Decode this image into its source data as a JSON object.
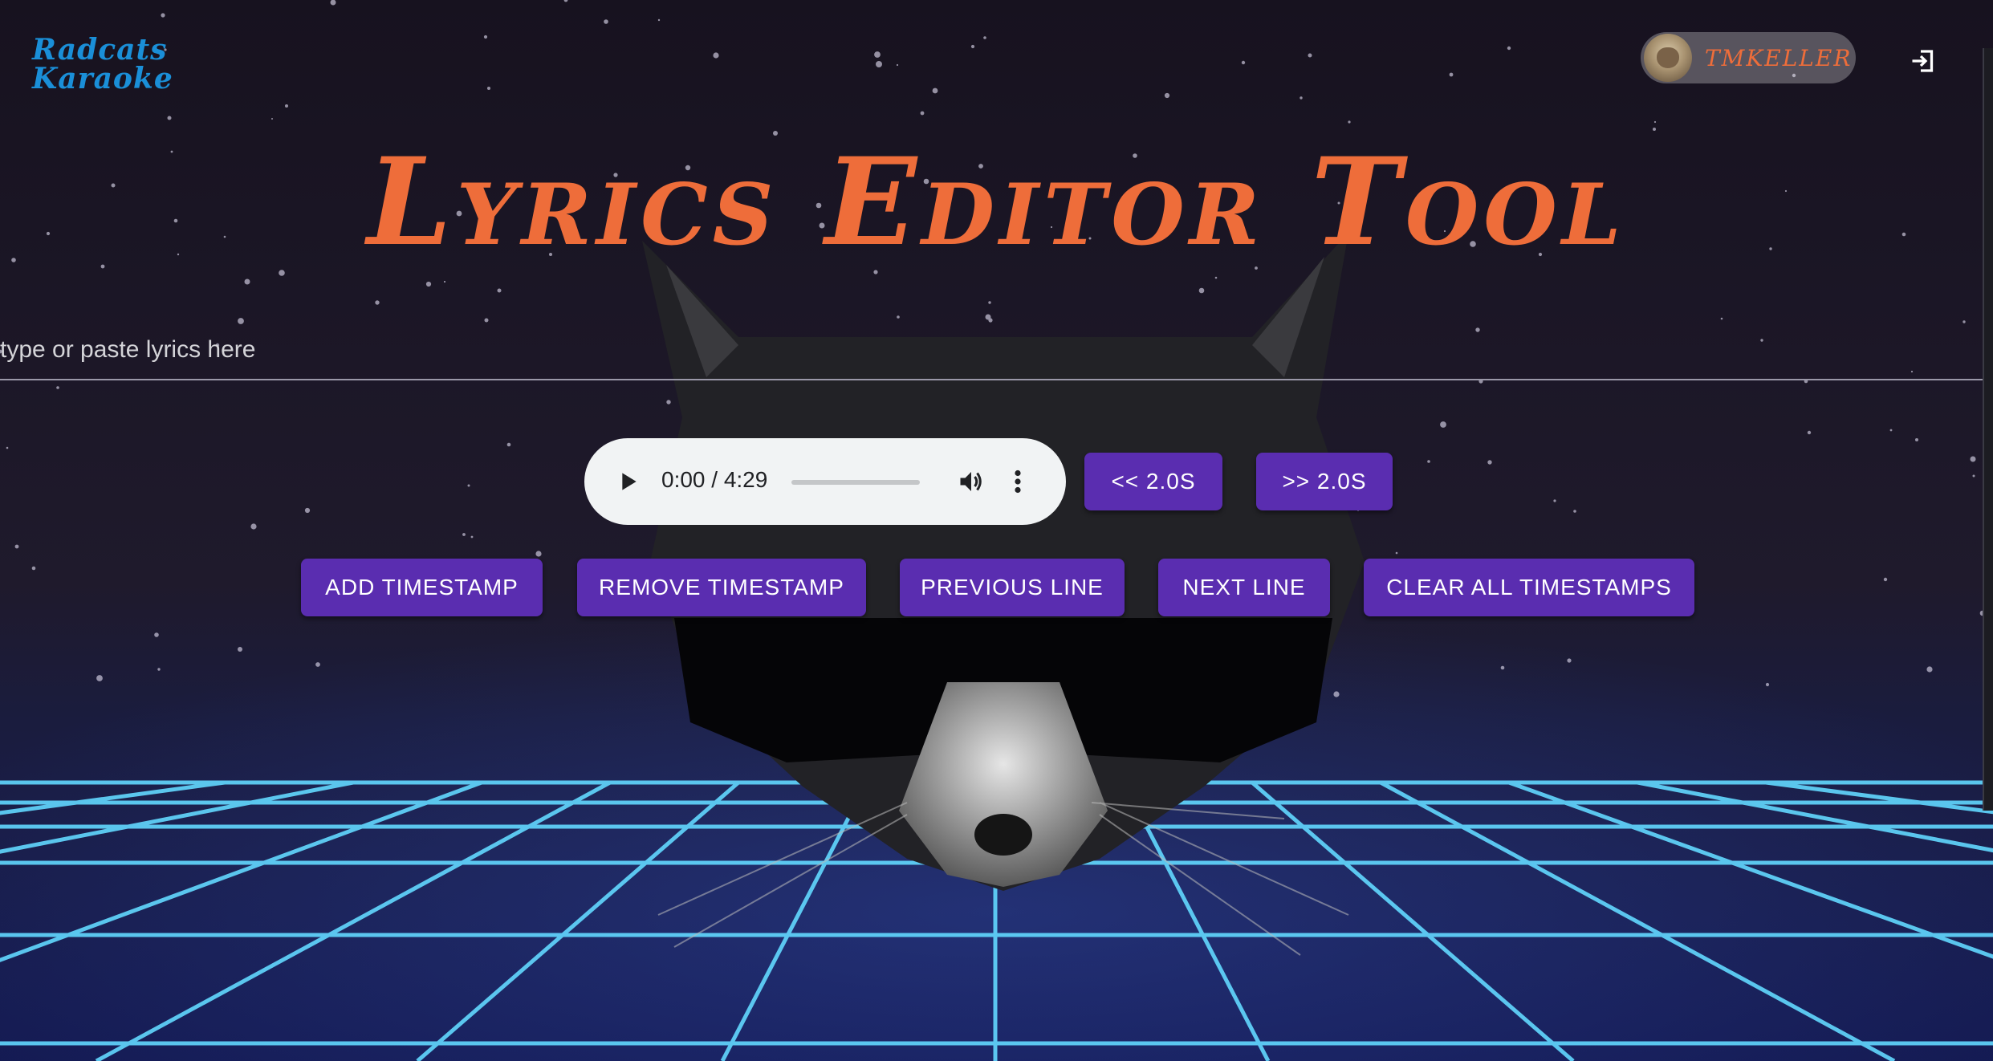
{
  "app": {
    "logo_line1": "Radcats",
    "logo_line2": "Karaoke"
  },
  "header": {
    "username": "TMKELLER",
    "avatar_icon": "cat-avatar-icon",
    "logout_icon": "logout-icon"
  },
  "page": {
    "title": "Lyrics Editor Tool"
  },
  "lyrics": {
    "placeholder": "type or paste lyrics here",
    "value": ""
  },
  "audio_player": {
    "time_display": "0:00 / 4:29",
    "progress": 0,
    "play_icon": "play-icon",
    "volume_icon": "volume-icon",
    "more_icon": "more-vertical-icon"
  },
  "seek_buttons": {
    "back_label": "<< 2.0S",
    "forward_label": ">> 2.0S"
  },
  "actions": {
    "add_timestamp": "ADD TIMESTAMP",
    "remove_timestamp": "REMOVE TIMESTAMP",
    "previous_line": "PREVIOUS LINE",
    "next_line": "NEXT LINE",
    "clear_all": "CLEAR ALL TIMESTAMPS"
  },
  "colors": {
    "accent_orange": "#ee6d3a",
    "logo_blue": "#1a8fd8",
    "button_purple": "#5a2db0",
    "grid_cyan": "#5fd8ff"
  }
}
